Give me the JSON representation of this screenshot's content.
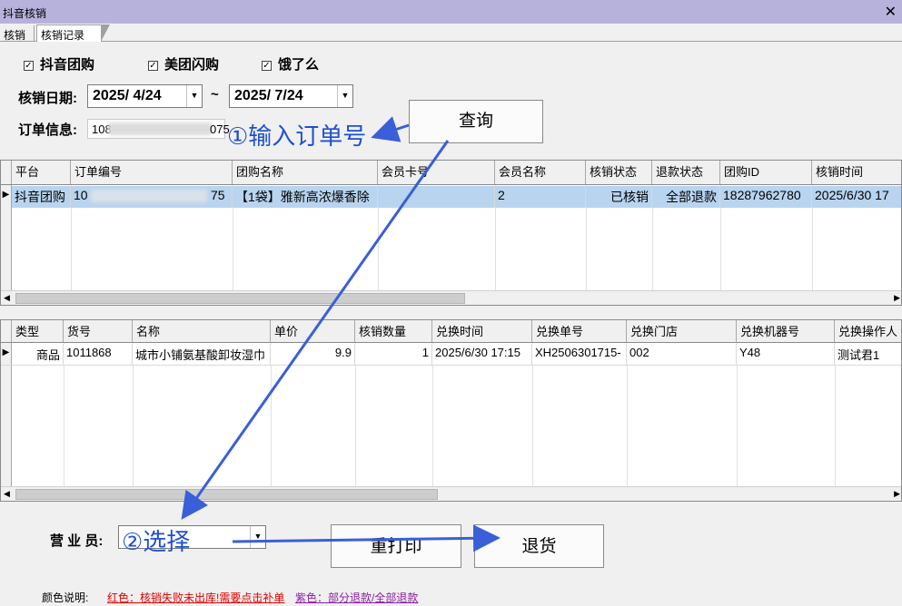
{
  "window": {
    "title": "抖音核销",
    "close_label": "✕"
  },
  "tabs": [
    {
      "label": "核销"
    },
    {
      "label": "核销记录"
    }
  ],
  "filters": {
    "platforms": [
      {
        "label": "抖音团购",
        "checked": true
      },
      {
        "label": "美团闪购",
        "checked": true
      },
      {
        "label": "饿了么",
        "checked": true
      }
    ],
    "date_label": "核销日期:",
    "date_from": "2025/  4/24",
    "date_sep": "~",
    "date_to": "2025/  7/24",
    "order_label": "订单信息:",
    "order_prefix": "108",
    "order_suffix": "075"
  },
  "buttons": {
    "query": "查询",
    "reprint": "重打印",
    "return": "退货"
  },
  "annotations": {
    "step1": "①输入订单号",
    "step2": "②选择"
  },
  "orders_table": {
    "columns": [
      "平台",
      "订单编号",
      "团购名称",
      "会员卡号",
      "会员名称",
      "核销状态",
      "退款状态",
      "团购ID",
      "核销时间"
    ],
    "rows": [
      {
        "platform": "抖音团购",
        "order_prefix": "10",
        "order_suffix": "75",
        "group_name": "【1袋】雅新高浓爆香除",
        "member_card": "",
        "member_name": "2",
        "verify_status": "已核销",
        "refund_status": "全部退款",
        "group_id": "18287962780",
        "verify_time": "2025/6/30 17"
      }
    ]
  },
  "items_table": {
    "columns": [
      "类型",
      "货号",
      "名称",
      "单价",
      "核销数量",
      "兑换时间",
      "兑换单号",
      "兑换门店",
      "兑换机器号",
      "兑换操作人"
    ],
    "rows": [
      {
        "type": "商品",
        "sku": "1011868",
        "name": "城市小铺氨基酸卸妆湿巾",
        "price": "9.9",
        "qty": "1",
        "time": "2025/6/30 17:15",
        "exchange_no": "XH2506301715-",
        "store": "002",
        "machine": "Y48",
        "operator": "测试君1"
      }
    ]
  },
  "clerk": {
    "label": "营 业 员:",
    "value": ""
  },
  "legend": {
    "title": "颜色说明:",
    "red": "红色：核销失败未出库!需要点击补单",
    "purple": "紫色：部分退款/全部退款"
  },
  "colors": {
    "titlebar": "#b7b2dc",
    "selection": "#b9d4ef",
    "annotation": "#1f4fd0",
    "legend_red": "#e00000",
    "legend_purple": "#8a1fa0"
  }
}
